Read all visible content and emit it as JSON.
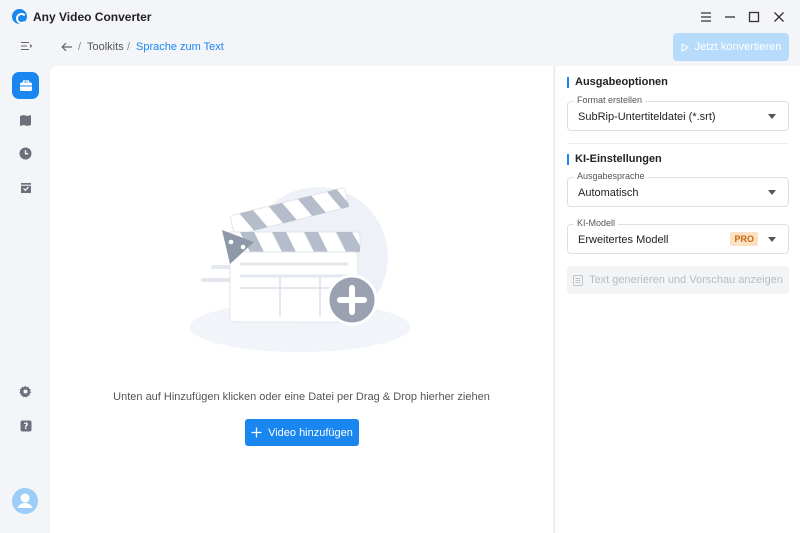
{
  "app": {
    "title": "Any Video Converter"
  },
  "header": {
    "breadcrumb_parent": "Toolkits",
    "breadcrumb_separator": "/",
    "breadcrumb_current": "Sprache zum Text",
    "convert_label": "Jetzt konvertieren"
  },
  "main": {
    "hint": "Unten auf Hinzufügen klicken oder eine Datei per Drag & Drop hierher ziehen",
    "add_button_label": "Video hinzufügen"
  },
  "panel": {
    "output": {
      "title": "Ausgabeoptionen",
      "format_label": "Format erstellen",
      "format_value": "SubRip-Untertiteldatei (*.srt)"
    },
    "ai": {
      "title": "KI-Einstellungen",
      "language_label": "Ausgabesprache",
      "language_value": "Automatisch",
      "model_label": "KI-Modell",
      "model_value": "Erweitertes Modell",
      "pro_badge": "PRO"
    },
    "generate_label": "Text generieren und Vorschau anzeigen"
  },
  "colors": {
    "accent": "#1a87f1",
    "accent_disabled": "#b7dcfb",
    "pro_bg": "#fce2c2",
    "pro_text": "#c56a12"
  }
}
